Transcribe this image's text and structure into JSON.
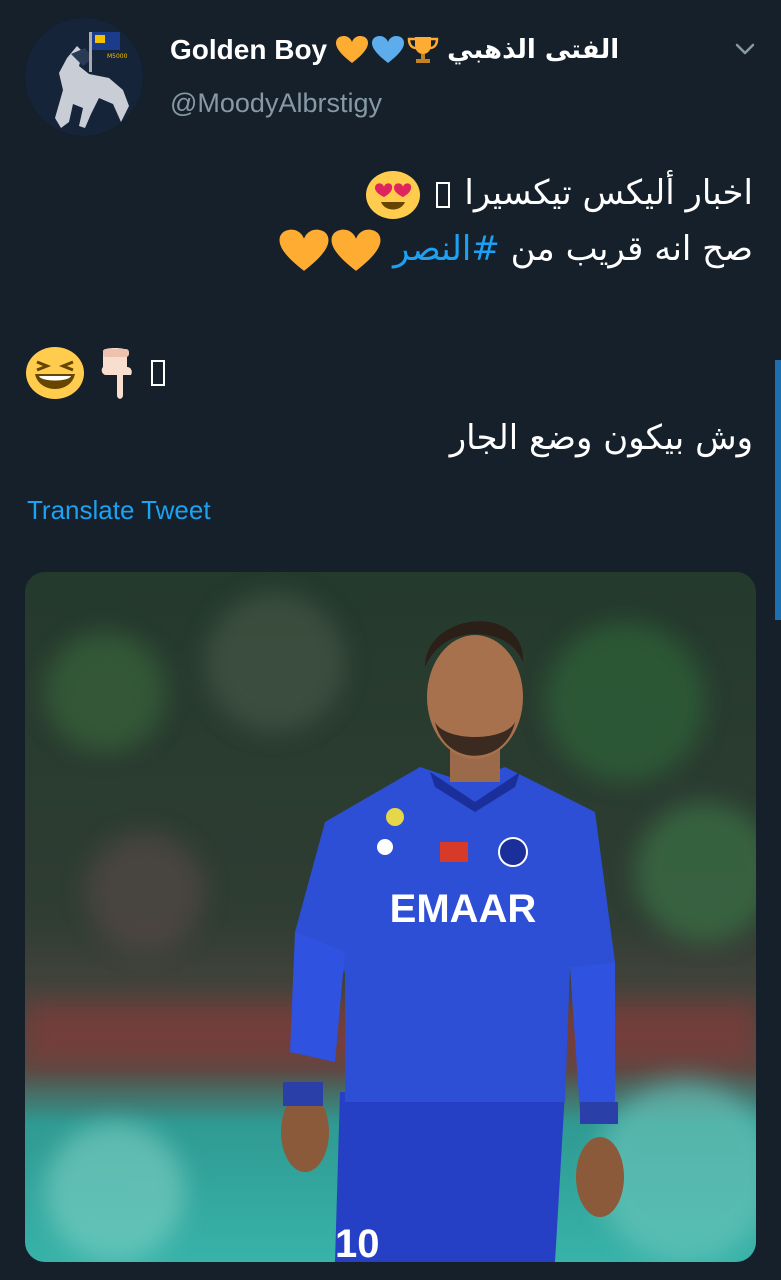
{
  "user": {
    "display_name": "Golden Boy",
    "emoji_icons": [
      "yellow-heart-icon",
      "blue-heart-icon",
      "trophy-icon"
    ],
    "arabic_name": "الفتى الذهبي",
    "handle": "@MoodyAlbrstigy"
  },
  "tweet": {
    "line1": "اخبار أليكس تيكسيرا",
    "line2_prefix": "صح انه قريب من ",
    "hashtag": "#النصر",
    "line3_emojis": [
      "grinning-squinting-face-icon",
      "pointing-down-hand-icon"
    ],
    "line4": "وش بيكون وضع الجار"
  },
  "actions": {
    "translate_label": "Translate Tweet"
  },
  "media": {
    "jersey_text": "EMAAR",
    "shirt_number": "10"
  },
  "colors": {
    "background": "#15202b",
    "link": "#1da1f2",
    "secondary_text": "#8899a6",
    "jersey_blue": "#2c4fd6"
  }
}
